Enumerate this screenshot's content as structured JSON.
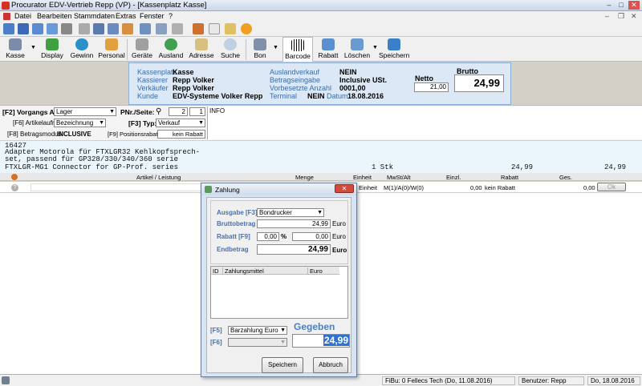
{
  "title": "Procurator EDV-Vertrieb Repp (VP) - [Kassenplatz Kasse]",
  "menu": [
    "Datei",
    "Bearbeiten",
    "Stammdaten",
    "Extras",
    "Fenster",
    "?"
  ],
  "ribbon": [
    "Kasse",
    "Display",
    "Gewinn",
    "Personal",
    "Geräte",
    "Ausland",
    "Adresse",
    "Suche",
    "Bon",
    "Barcode",
    "Rabatt",
    "Löschen",
    "Speichern"
  ],
  "info": {
    "kassenplatz_label": "Kassenplatz",
    "kassenplatz": "Kasse",
    "kassierer_label": "Kassierer",
    "kassierer": "Repp Volker",
    "verkaeufer_label": "Verkäufer",
    "verkaeufer": "Repp Volker",
    "kunde_label": "Kunde",
    "kunde": "EDV-Systeme Volker Repp",
    "auslandverkauf_label": "Auslandverkauf",
    "auslandverkauf": "NEIN",
    "betragseingabe_label": "Betragseingabe",
    "betragseingabe": "Inclusive USt.",
    "vorbesetzte_label": "Vorbesetzte Anzahl",
    "vorbesetzte": "0001,00",
    "terminal_label": "Terminal",
    "terminal": "NEIN",
    "datum_label": "Datum",
    "datum": "18.08.2016",
    "netto_label": "Netto",
    "netto": "21,00",
    "brutto_label": "Brutto",
    "brutto": "24,99"
  },
  "form": {
    "vorgangsart_label": "[F2] Vorgangs Art:",
    "vorgangsart": "Lager",
    "pnr_label": "PNr./Seite:",
    "pnr1": "2",
    "pnr2": "1",
    "info_text": "INFO",
    "artikelaufruf_label": "[F6] Artikelaufruf:",
    "artikelaufruf": "Bezeichnung",
    "typ_label": "[F3] Typ:",
    "typ": "Verkauf",
    "betragsmodus_label": "[F8] Betragsmodus:",
    "betragsmodus": "INCLUSIVE",
    "positionsrabatt_label": "[F9] Positionsrabatt:",
    "positionsrabatt": "kein Rabatt"
  },
  "receipt": {
    "line1": "16427",
    "line2": "Adapter Motorola für FTXLGR32 Kehlkopfsprech-",
    "line3": "set, passend für GP328/330/340/360 serie",
    "line4": "FTXLGR-MG1 Connector for GP-Prof. series",
    "qty": "1 Stk",
    "price": "24,99",
    "total": "24,99"
  },
  "grid": {
    "headers": [
      "Artikel / Leistung",
      "Menge",
      "Einheit",
      "MwSt/Alt",
      "Einzl.",
      "Rabatt",
      "Ges."
    ],
    "row": {
      "einheit": "Einheit",
      "mwst": "M(1)/A(0)/W(0)",
      "einzl": "0,00",
      "rabatt": "kein Rabatt",
      "ges": "0,00",
      "ok": "Ok"
    }
  },
  "dialog": {
    "title": "Zahlung",
    "ausgabe_label": "Ausgabe [F3]",
    "ausgabe": "Bondrucker",
    "bruttobetrag_label": "Bruttobetrag",
    "bruttobetrag": "24,99",
    "euro": "Euro",
    "rabatt_label": "Rabatt [F9]",
    "rabatt_pct": "0,00",
    "pct": "%",
    "rabatt_val": "0,00",
    "endbetrag_label": "Endbetrag",
    "endbetrag": "24,99",
    "list_headers": [
      "ID",
      "Zahlungsmittel",
      "Euro"
    ],
    "f5_label": "[F5]",
    "f5": "Barzahlung Euro",
    "f6_label": "[F6]",
    "gegeben_label": "Gegeben",
    "gegeben": "24,99",
    "speichern": "Speichern",
    "abbruch": "Abbruch"
  },
  "status": {
    "fibu": "FiBu: 0 Fellecs Tech (Do, 11.08.2016)",
    "benutzer": "Benutzer: Repp",
    "datum": "Do, 18.08.2016"
  }
}
